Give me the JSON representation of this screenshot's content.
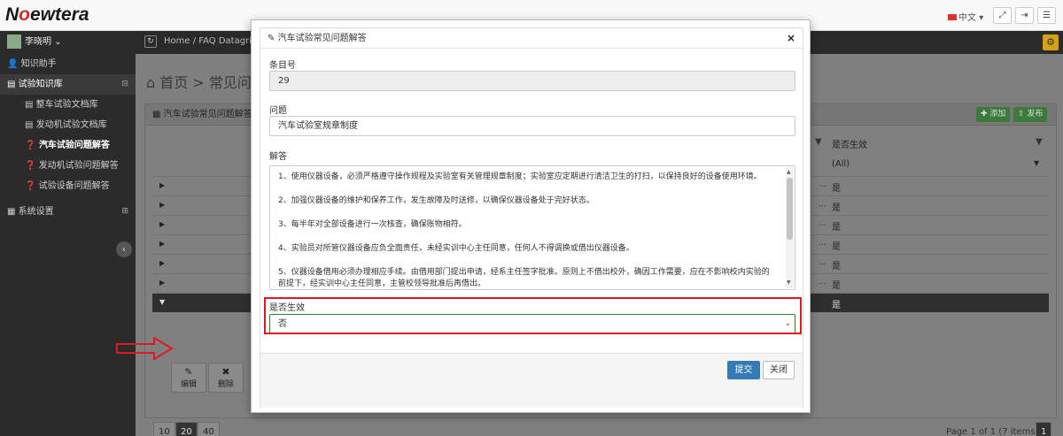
{
  "topbar": {
    "logo_n": "N",
    "logo_ewtera": "ewtera",
    "lang": "中文",
    "lang_caret": "▾"
  },
  "sidebar": {
    "user_name": "李晓明",
    "user_caret": "⌄",
    "items": [
      {
        "label": "知识助手"
      },
      {
        "label": "试验知识库"
      },
      {
        "label": "整车试验文档库"
      },
      {
        "label": "发动机试验文档库"
      },
      {
        "label": "汽车试验问题解答"
      },
      {
        "label": "发动机试验问题解答"
      },
      {
        "label": "试验设备问题解答"
      },
      {
        "label": "系统设置"
      }
    ]
  },
  "breadcrumb": {
    "home": "Home",
    "separator": "/",
    "current": "FAQ Datagrid"
  },
  "page_heading": "首页 > 常见问题解答",
  "panel": {
    "title": "汽车试验常见问题解答",
    "add_label": "添加",
    "publish_label": "发布",
    "column_header": "是否生效",
    "filter_value": "(All)",
    "rows": [
      {
        "value": "是"
      },
      {
        "value": "是"
      },
      {
        "value": "是"
      },
      {
        "value": "是"
      },
      {
        "value": "是"
      },
      {
        "value": "是"
      },
      {
        "value": "是"
      }
    ],
    "edit_label": "编辑",
    "delete_label": "删除",
    "page_sizes": [
      "10",
      "20",
      "40"
    ],
    "page_info": "Page 1 of 1 (7 items)",
    "current_page": "1"
  },
  "modal": {
    "title": "汽车试验常见问题解答",
    "close_glyph": "×",
    "id_label": "条目号",
    "id_value": "29",
    "question_label": "问题",
    "question_value": "汽车试验室规章制度",
    "answer_label": "解答",
    "answer_paragraphs": [
      "1、使用仪器设备，必须严格遵守操作规程及实验室有关管理规章制度；实验室应定期进行清洁卫生的打扫，以保持良好的设备使用环境。",
      "2、加强仪器设备的维护和保养工作，发生故障及时送修，以确保仪器设备处于完好状态。",
      "3、每半年对全部设备进行一次核查，确保账物相符。",
      "4、实验员对所管仪器设备应负全面责任，未经实训中心主任同意，任何人不得调换或借出仪器设备。",
      "5、仪器设备借用必须办理相应手续。由借用部门提出申请，经系主任签字批准。原则上不借出校外，确因工作需要，应在不影响校内实验的前提下，经实训中心主任同意，主管校领导批准后再借出。"
    ],
    "effective_label": "是否生效",
    "effective_value": "否",
    "submit_label": "提交",
    "close_label": "关闭"
  },
  "colors": {
    "highlight": "#e0191f",
    "primary": "#337ab7",
    "success": "#2e7d32"
  }
}
